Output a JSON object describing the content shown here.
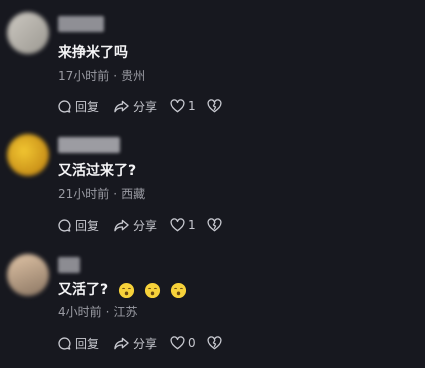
{
  "comments": [
    {
      "text": "来挣米了吗",
      "time": "17小时前",
      "separator": "·",
      "location": "贵州",
      "reply_label": "回复",
      "share_label": "分享",
      "like_count": "1",
      "avatar_colors": [
        "#c8c4bd",
        "#9b9891"
      ],
      "username_color": "#8f8f95"
    },
    {
      "text": "又活过来了?",
      "time": "21小时前",
      "separator": "·",
      "location": "西藏",
      "reply_label": "回复",
      "share_label": "分享",
      "like_count": "1",
      "avatar_colors": [
        "#e6b624",
        "#c99018"
      ],
      "username_color": "#9c9ca2"
    },
    {
      "text": "又活了?",
      "emoji": "yawning-face",
      "emoji_count": 3,
      "time": "4小时前",
      "separator": "·",
      "location": "江苏",
      "reply_label": "回复",
      "share_label": "分享",
      "like_count": "0",
      "avatar_colors": [
        "#d6b89c",
        "#8a7562"
      ],
      "username_color": "#8c8c92"
    }
  ],
  "colors": {
    "background": "#17181f",
    "text_primary": "#f4f4f6",
    "text_secondary": "#9a9ba3",
    "action_text": "#c7c8cf",
    "emoji": "#f7d23a"
  },
  "icons": {
    "reply": "speech-bubble-icon",
    "share": "share-arrow-icon",
    "like": "heart-icon",
    "dislike": "broken-heart-icon"
  }
}
